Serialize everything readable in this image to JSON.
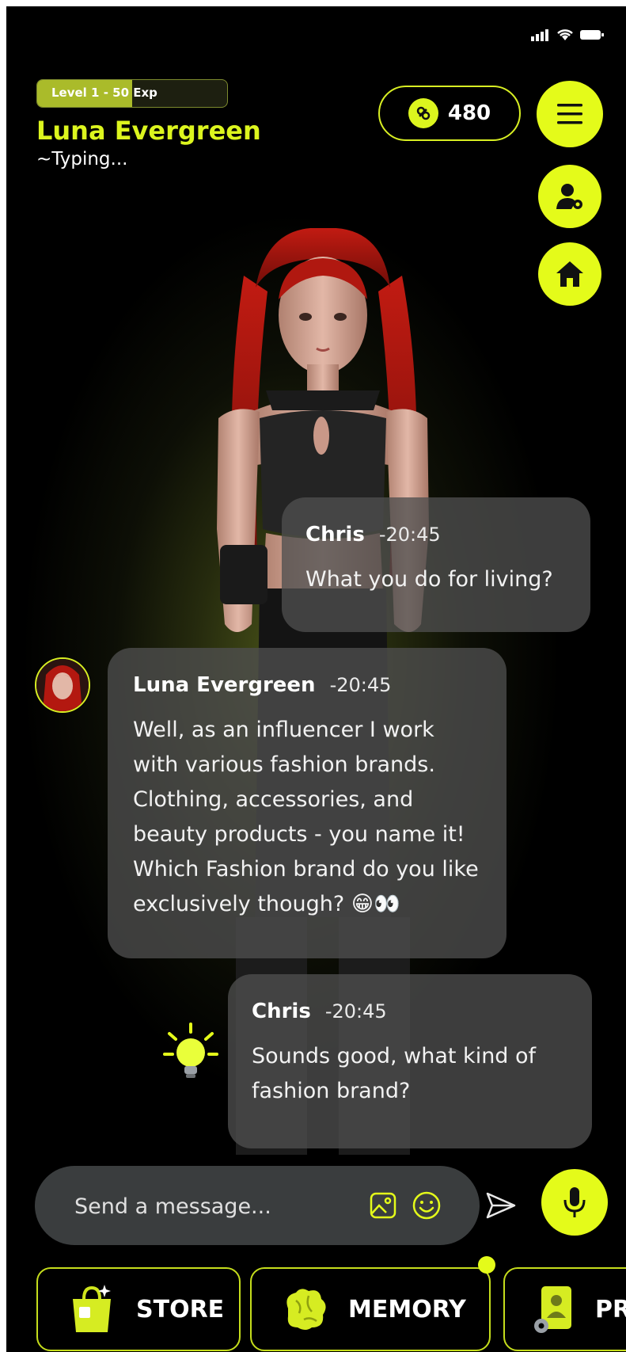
{
  "status_bar": {
    "icons": [
      "signal-icon",
      "wifi-icon",
      "battery-icon"
    ]
  },
  "character": {
    "level_label": "Level 1 - 50 Exp",
    "level_progress": 0.5,
    "name": "Luna Evergreen",
    "status": "~Typing..."
  },
  "coins": {
    "value": "480",
    "icon": "coin-icon"
  },
  "side_buttons": [
    {
      "name": "menu",
      "icon": "hamburger-icon"
    },
    {
      "name": "profile-settings",
      "icon": "user-gear-icon"
    },
    {
      "name": "home",
      "icon": "home-icon"
    }
  ],
  "messages": [
    {
      "sender": "Chris",
      "time": "-20:45",
      "text": "What you do for living?"
    },
    {
      "sender": "Luna Evergreen",
      "time": "-20:45",
      "text": "Well, as an influencer I work with various fashion brands. Clothing, accessories, and beauty products - you name it! Which Fashion brand do you like exclusively though? 😁👀"
    },
    {
      "sender": "Chris",
      "time": "-20:45",
      "text": "Sounds good, what kind of fashion brand?"
    }
  ],
  "composer": {
    "placeholder": "Send a message..."
  },
  "tabs": [
    {
      "label": "STORE",
      "icon": "shopping-bag-icon"
    },
    {
      "label": "MEMORY",
      "icon": "brain-icon"
    },
    {
      "label": "PR",
      "icon": "profile-card-icon"
    }
  ],
  "colors": {
    "accent": "#E4FB1A",
    "bubble": "#4E4E4E",
    "background": "#000000"
  }
}
